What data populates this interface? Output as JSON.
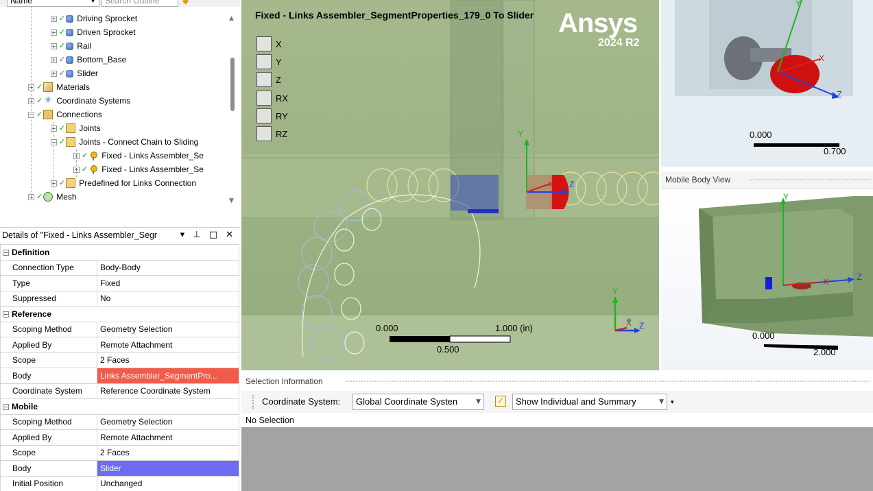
{
  "outline": {
    "sort_label": "Name",
    "search_placeholder": "Search Outline",
    "items": [
      {
        "label": "Driving Sprocket"
      },
      {
        "label": "Driven Sprocket"
      },
      {
        "label": "Rail"
      },
      {
        "label": "Bottom_Base"
      },
      {
        "label": "Slider"
      },
      {
        "label": "Materials"
      },
      {
        "label": "Coordinate Systems"
      },
      {
        "label": "Connections"
      },
      {
        "label": "Joints"
      },
      {
        "label": "Joints - Connect Chain to Sliding"
      },
      {
        "label": "Fixed - Links Assembler_Se"
      },
      {
        "label": "Fixed - Links Assembler_Se"
      },
      {
        "label": "Predefined for Links Connection"
      },
      {
        "label": "Mesh"
      }
    ]
  },
  "details": {
    "title": "Details of \"Fixed - Links Assembler_Segr",
    "header_icons": "▾ ⊥ □ ✕",
    "sections": {
      "definition": "Definition",
      "reference": "Reference",
      "mobile": "Mobile"
    },
    "rows": {
      "connection_type": {
        "k": "Connection Type",
        "v": "Body-Body"
      },
      "type": {
        "k": "Type",
        "v": "Fixed"
      },
      "suppressed": {
        "k": "Suppressed",
        "v": "No"
      },
      "ref_scoping": {
        "k": "Scoping Method",
        "v": "Geometry Selection"
      },
      "ref_applied": {
        "k": "Applied By",
        "v": "Remote Attachment"
      },
      "ref_scope": {
        "k": "Scope",
        "v": "2 Faces"
      },
      "ref_body": {
        "k": "Body",
        "v": "Links Assembler_SegmentPro..."
      },
      "ref_cs": {
        "k": "Coordinate System",
        "v": "Reference Coordinate System"
      },
      "mob_scoping": {
        "k": "Scoping Method",
        "v": "Geometry Selection"
      },
      "mob_applied": {
        "k": "Applied By",
        "v": "Remote Attachment"
      },
      "mob_scope": {
        "k": "Scope",
        "v": "2 Faces"
      },
      "mob_body": {
        "k": "Body",
        "v": "Slider"
      },
      "mob_init": {
        "k": "Initial Position",
        "v": "Unchanged"
      }
    },
    "colors": {
      "reference_body": "#f15b4a",
      "mobile_body": "#6c6cf2"
    }
  },
  "viewport": {
    "title": "Fixed - Links Assembler_SegmentProperties_179_0 To Slider",
    "brand": "Ansys",
    "version": "2024 R2",
    "dof": [
      "X",
      "Y",
      "Z",
      "RX",
      "RY",
      "RZ"
    ],
    "scale": {
      "left": "0.000",
      "right": "1.000 (in)",
      "mid": "0.500"
    },
    "axes": {
      "x": "X",
      "y": "Y",
      "z": "Z"
    }
  },
  "reference_view": {
    "scale": {
      "left": "0.000",
      "right": "0.700"
    },
    "axes": {
      "x": "X",
      "y": "Y",
      "z": "Z"
    }
  },
  "mobile_view": {
    "title": "Mobile Body View",
    "scale": {
      "left": "0.000",
      "right": "2.000"
    },
    "axes": {
      "x": "X",
      "y": "Y",
      "z": "Z"
    }
  },
  "selection_info": {
    "title": "Selection Information",
    "cs_label": "Coordinate System:",
    "cs_value": "Global Coordinate Systen",
    "mode_value": "Show Individual and Summary",
    "status": "No Selection"
  }
}
